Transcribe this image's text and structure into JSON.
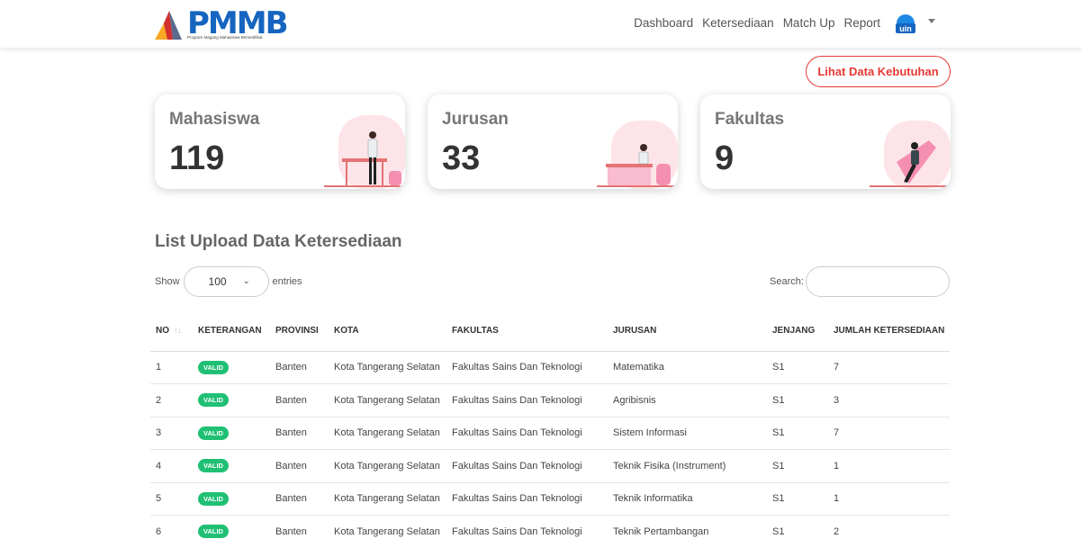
{
  "brand": {
    "name": "PMMB",
    "tagline": "Program Magang Mahasiswa Bersertifikat"
  },
  "nav": {
    "items": [
      "Dashboard",
      "Ketersediaan",
      "Match Up",
      "Report"
    ],
    "avatar_label": "uin"
  },
  "actions": {
    "lihat_kebutuhan": "Lihat Data Kebutuhan"
  },
  "cards": [
    {
      "label": "Mahasiswa",
      "value": "119",
      "icon": "person-standing-desk-illustration"
    },
    {
      "label": "Jurusan",
      "value": "33",
      "icon": "person-at-desk-illustration"
    },
    {
      "label": "Fakultas",
      "value": "9",
      "icon": "person-on-chair-illustration"
    }
  ],
  "list": {
    "title": "List Upload Data Ketersediaan",
    "show_label": "Show",
    "entries_value": "100",
    "entries_label": "entries",
    "search_label": "Search:",
    "search_value": "",
    "columns": [
      "NO",
      "KETERANGAN",
      "PROVINSI",
      "KOTA",
      "FAKULTAS",
      "JURUSAN",
      "JENJANG",
      "JUMLAH KETERSEDIAAN"
    ],
    "rows": [
      {
        "no": "1",
        "status": "VALID",
        "provinsi": "Banten",
        "kota": "Kota Tangerang Selatan",
        "fakultas": "Fakultas Sains Dan Teknologi",
        "jurusan": "Matematika",
        "jenjang": "S1",
        "jumlah": "7"
      },
      {
        "no": "2",
        "status": "VALID",
        "provinsi": "Banten",
        "kota": "Kota Tangerang Selatan",
        "fakultas": "Fakultas Sains Dan Teknologi",
        "jurusan": "Agribisnis",
        "jenjang": "S1",
        "jumlah": "3"
      },
      {
        "no": "3",
        "status": "VALID",
        "provinsi": "Banten",
        "kota": "Kota Tangerang Selatan",
        "fakultas": "Fakultas Sains Dan Teknologi",
        "jurusan": "Sistem Informasi",
        "jenjang": "S1",
        "jumlah": "7"
      },
      {
        "no": "4",
        "status": "VALID",
        "provinsi": "Banten",
        "kota": "Kota Tangerang Selatan",
        "fakultas": "Fakultas Sains Dan Teknologi",
        "jurusan": "Teknik Fisika (Instrument)",
        "jenjang": "S1",
        "jumlah": "1"
      },
      {
        "no": "5",
        "status": "VALID",
        "provinsi": "Banten",
        "kota": "Kota Tangerang Selatan",
        "fakultas": "Fakultas Sains Dan Teknologi",
        "jurusan": "Teknik Informatika",
        "jenjang": "S1",
        "jumlah": "1"
      },
      {
        "no": "6",
        "status": "VALID",
        "provinsi": "Banten",
        "kota": "Kota Tangerang Selatan",
        "fakultas": "Fakultas Sains Dan Teknologi",
        "jurusan": "Teknik Pertambangan",
        "jenjang": "S1",
        "jumlah": "2"
      }
    ]
  },
  "colors": {
    "accent_red": "#e53935",
    "valid_green": "#20c074",
    "brand_blue": "#1565c0"
  }
}
